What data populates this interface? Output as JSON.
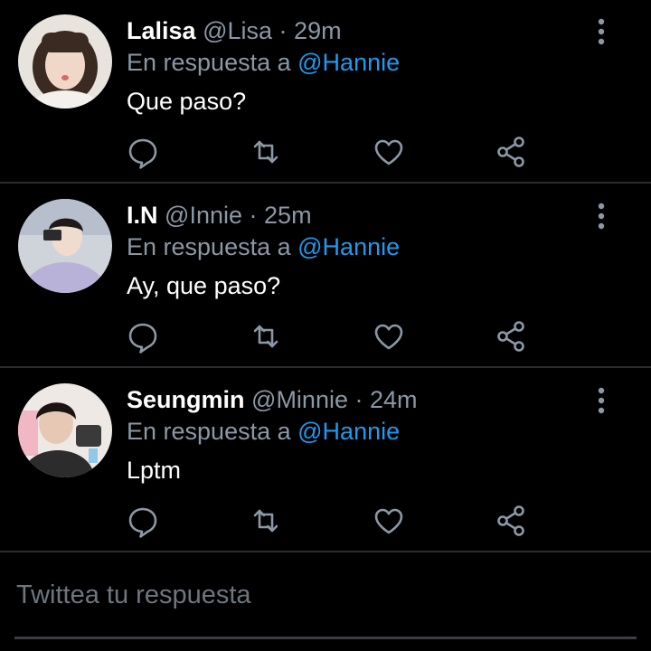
{
  "tweets": [
    {
      "name": "Lalisa",
      "handle": "@Lisa",
      "time": "29m",
      "reply_prefix": "En respuesta a",
      "reply_to": "@Hannie",
      "text": "Que paso?"
    },
    {
      "name": "I.N",
      "handle": "@Innie",
      "time": "25m",
      "reply_prefix": "En respuesta a",
      "reply_to": "@Hannie",
      "text": "Ay, que paso?"
    },
    {
      "name": "Seungmin",
      "handle": "@Minnie",
      "time": "24m",
      "reply_prefix": "En respuesta a",
      "reply_to": "@Hannie",
      "text": "Lptm"
    }
  ],
  "separator": "·",
  "compose": {
    "placeholder": "Twittea tu respuesta"
  },
  "icons": [
    "reply-icon",
    "retweet-icon",
    "like-icon",
    "share-icon",
    "more-options-icon"
  ],
  "colors": {
    "background": "#000000",
    "mention": "#1d9bf0",
    "muted": "#8b98a5",
    "divider": "#2a2d30"
  }
}
